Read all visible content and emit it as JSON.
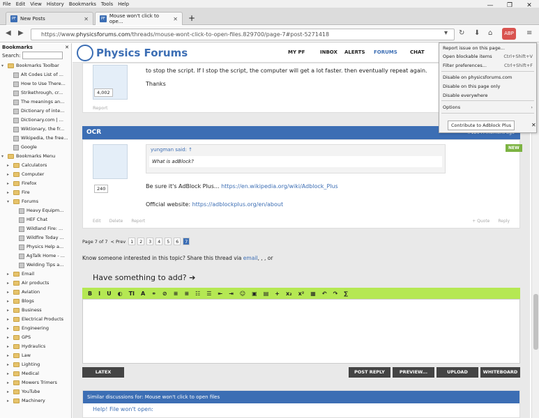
{
  "menubar": [
    "File",
    "Edit",
    "View",
    "History",
    "Bookmarks",
    "Tools",
    "Help"
  ],
  "tabs": [
    {
      "label": "New Posts",
      "favicon": "PF"
    },
    {
      "label": "Mouse won't click to ope...",
      "favicon": "PF"
    }
  ],
  "urlbar": {
    "prefix": "https://www.",
    "domain": "physicsforums.com",
    "path": "/threads/mouse-wont-click-to-open-files.829700/page-7#post-5271418"
  },
  "sidebar": {
    "title": "Bookmarks",
    "search_label": "Search:",
    "items": [
      {
        "label": "Bookmarks Toolbar",
        "type": "toolbar",
        "expanded": true,
        "level": 0
      },
      {
        "label": "Alt Codes List of ...",
        "type": "page",
        "level": 1
      },
      {
        "label": "How to Use There...",
        "type": "page",
        "level": 1
      },
      {
        "label": "Strikethrough, cr...",
        "type": "page",
        "level": 1
      },
      {
        "label": "The meanings an...",
        "type": "page",
        "level": 1
      },
      {
        "label": "Dictionary of inte...",
        "type": "page",
        "level": 1
      },
      {
        "label": "Dictionary.com | ...",
        "type": "page",
        "level": 1
      },
      {
        "label": "Wiktionary, the fr...",
        "type": "page",
        "level": 1
      },
      {
        "label": "Wikipedia, the free...",
        "type": "page",
        "level": 1
      },
      {
        "label": "Google",
        "type": "page",
        "level": 1
      },
      {
        "label": "Bookmarks Menu",
        "type": "menu",
        "expanded": true,
        "level": 0
      },
      {
        "label": "Calculators",
        "type": "folder",
        "level": 1
      },
      {
        "label": "Computer",
        "type": "folder",
        "level": 1
      },
      {
        "label": "Firefox",
        "type": "folder",
        "level": 1
      },
      {
        "label": "Fire",
        "type": "folder",
        "level": 1
      },
      {
        "label": "Forums",
        "type": "folder",
        "expanded": true,
        "level": 1
      },
      {
        "label": "Heavy Equipm...",
        "type": "page",
        "level": 2
      },
      {
        "label": "HEF Chat",
        "type": "page",
        "level": 2
      },
      {
        "label": "Wildland Fire: ...",
        "type": "page",
        "level": 2
      },
      {
        "label": "Wildfire Today ...",
        "type": "page",
        "level": 2
      },
      {
        "label": "Physics Help a...",
        "type": "page",
        "level": 2
      },
      {
        "label": "AgTalk Home - ...",
        "type": "page",
        "level": 2
      },
      {
        "label": "Welding Tips a...",
        "type": "page",
        "level": 2
      },
      {
        "label": "Email",
        "type": "folder",
        "level": 1
      },
      {
        "label": "Air products",
        "type": "folder",
        "level": 1
      },
      {
        "label": "Aviation",
        "type": "folder",
        "level": 1
      },
      {
        "label": "Blogs",
        "type": "folder",
        "level": 1
      },
      {
        "label": "Business",
        "type": "folder",
        "level": 1
      },
      {
        "label": "Electrical Products",
        "type": "folder",
        "level": 1
      },
      {
        "label": "Engineering",
        "type": "folder",
        "level": 1
      },
      {
        "label": "GPS",
        "type": "folder",
        "level": 1
      },
      {
        "label": "Hydraulics",
        "type": "folder",
        "level": 1
      },
      {
        "label": "Law",
        "type": "folder",
        "level": 1
      },
      {
        "label": "Lighting",
        "type": "folder",
        "level": 1
      },
      {
        "label": "Medical",
        "type": "folder",
        "level": 1
      },
      {
        "label": "Mowers Trimers",
        "type": "folder",
        "level": 1
      },
      {
        "label": "YouTube",
        "type": "folder",
        "level": 1
      },
      {
        "label": "Machinery",
        "type": "folder",
        "level": 1
      }
    ]
  },
  "site": {
    "logo": "Physics Forums",
    "nav": [
      "MY PF",
      "INBOX",
      "ALERTS",
      "FORUMS",
      "CHAT"
    ]
  },
  "post1": {
    "text_top": "...",
    "text1": "to stop the script. If I stop the script, the computer will get a lot faster. then eventually repeat again.",
    "text2": "Thanks",
    "post_count": "4,002",
    "report": "Report"
  },
  "post2": {
    "author": "OCR",
    "meta": "#129   A moment ago",
    "badge": "NEW",
    "post_count": "240",
    "quote_author": "yungman said: ↑",
    "quote_text": "What is adBlock?",
    "text1": "Be sure it's AdBlock Plus... ",
    "link1": "https://en.wikipedia.org/wiki/Adblock_Plus",
    "text2": "Official website: ",
    "link2": "https://adblockplus.org/en/about",
    "actions": [
      "Edit",
      "Delete",
      "Report"
    ],
    "actions_right": [
      "+ Quote",
      "Reply"
    ]
  },
  "pagination": {
    "label": "Page 7 of 7",
    "prev": "< Prev",
    "pages": [
      "1",
      "2",
      "3",
      "4",
      "5",
      "6",
      "7"
    ],
    "current": "7"
  },
  "share": {
    "text": "Know someone interested in this topic? Share this thread via ",
    "email": "email",
    "tail": ", , , or"
  },
  "reply": {
    "heading": "Have something to add? ➔",
    "buttons": {
      "latex": "LATEX",
      "post": "POST REPLY",
      "preview": "PREVIEW...",
      "upload": "UPLOAD",
      "whiteboard": "WHITEBOARD"
    }
  },
  "toolbar_icons": [
    "B",
    "I",
    "U",
    "◐",
    "TI",
    "A",
    "⚭",
    "⊘",
    "≡",
    "≡",
    "☷",
    "☰",
    "⇤",
    "⇥",
    "☺",
    "▣",
    "▤",
    "+",
    "x₂",
    "x²",
    "▦",
    "↶",
    "↷",
    "∑"
  ],
  "similar": {
    "heading": "Similar discussions for: Mouse won't click to open files",
    "first": "Help! File won't open:"
  },
  "abp_menu": {
    "items": [
      {
        "label": "Report issue on this page...",
        "shortcut": ""
      },
      {
        "label": "Open blockable items",
        "shortcut": "Ctrl+Shift+V"
      },
      {
        "label": "Filter preferences...",
        "shortcut": "Ctrl+Shift+F"
      },
      {
        "label": "Disable on physicsforums.com",
        "shortcut": ""
      },
      {
        "label": "Disable on this page only",
        "shortcut": ""
      },
      {
        "label": "Disable everywhere",
        "shortcut": ""
      },
      {
        "label": "Options",
        "shortcut": "›"
      }
    ],
    "contribute": "Contribute to Adblock Plus"
  },
  "colors": {
    "accent": "#3c6eb4",
    "editor": "#b5e853",
    "new_badge": "#7cb342"
  }
}
